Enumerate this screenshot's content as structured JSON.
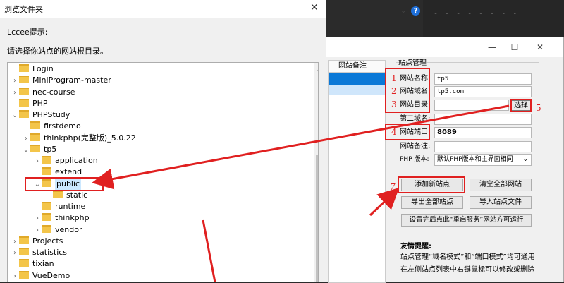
{
  "editor": {
    "dash_text": "- - - - - - - -",
    "help_icon": "?"
  },
  "site_window": {
    "list_header": "网站备注",
    "group_title": "站点管理",
    "fields": [
      {
        "label": "网站名称:",
        "value": "tp5"
      },
      {
        "label": "网站域名:",
        "value": "tp5.com"
      },
      {
        "label": "网站目录:",
        "value": ""
      },
      {
        "label": "第二域名:",
        "value": ""
      },
      {
        "label": "网站端口:",
        "value": "8089"
      },
      {
        "label": "网站备注:",
        "value": ""
      }
    ],
    "choose_button": "选择",
    "php_label": "PHP 版本:",
    "php_selected": "默认PHP版本和主界面相同",
    "buttons": {
      "add_site": "添加新站点",
      "clear_all": "清空全部网站",
      "export_all": "导出全部站点",
      "import_file": "导入站点文件",
      "after_setup": "设置完后点此“重启服务”网站方可运行"
    },
    "tips_title": "友情提醒:",
    "tips_lines": [
      "站点管理“域名模式”和“端口模式”均可通用",
      "在左侧站点列表中右键鼠标可以修改或删除"
    ]
  },
  "annotations": {
    "n1": "1",
    "n2": "2",
    "n3": "3",
    "n4": "4",
    "n5": "5",
    "n7": "7"
  },
  "dialog": {
    "title": "浏览文件夹",
    "prompt": "Lccee提示:",
    "instruction": "请选择你站点的网站根目录。",
    "tree": [
      {
        "label": "Login",
        "level": 1,
        "toggle": ""
      },
      {
        "label": "MiniProgram-master",
        "level": 1,
        "toggle": ">"
      },
      {
        "label": "nec-course",
        "level": 1,
        "toggle": ">"
      },
      {
        "label": "PHP",
        "level": 1,
        "toggle": ""
      },
      {
        "label": "PHPStudy",
        "level": 1,
        "toggle": "v"
      },
      {
        "label": "firstdemo",
        "level": 2,
        "toggle": ""
      },
      {
        "label": "thinkphp(完整版)_5.0.22",
        "level": 2,
        "toggle": ">"
      },
      {
        "label": "tp5",
        "level": 2,
        "toggle": "v"
      },
      {
        "label": "application",
        "level": 3,
        "toggle": ">"
      },
      {
        "label": "extend",
        "level": 3,
        "toggle": ""
      },
      {
        "label": "public",
        "level": 3,
        "toggle": "v"
      },
      {
        "label": "static",
        "level": 4,
        "toggle": ""
      },
      {
        "label": "runtime",
        "level": 3,
        "toggle": ""
      },
      {
        "label": "thinkphp",
        "level": 3,
        "toggle": ">"
      },
      {
        "label": "vendor",
        "level": 3,
        "toggle": ">"
      },
      {
        "label": "Projects",
        "level": 1,
        "toggle": ">"
      },
      {
        "label": "statistics",
        "level": 1,
        "toggle": ">"
      },
      {
        "label": "tixian",
        "level": 1,
        "toggle": ""
      },
      {
        "label": "VueDemo",
        "level": 1,
        "toggle": ">"
      }
    ]
  },
  "colors": {
    "annotation_red": "#e02020",
    "selection_blue": "#0a78d7"
  }
}
